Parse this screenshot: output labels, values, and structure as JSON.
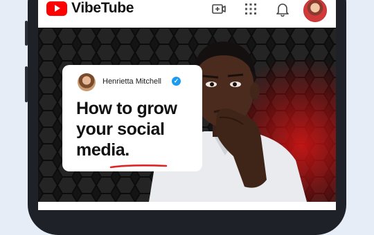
{
  "app": {
    "name": "VibeTube"
  },
  "icons": {
    "logo": "play-logo-icon",
    "create": "create-video-icon",
    "apps": "apps-grid-icon",
    "notifications": "bell-icon",
    "avatar": "user-avatar"
  },
  "thumbnail": {
    "creator_name": "Henrietta Mitchell",
    "verified_icon": "verified-check-icon",
    "headline_lines": [
      "How to grow",
      "your social",
      "media."
    ]
  },
  "colors": {
    "brand_red": "#ff0000",
    "verified_blue": "#1d9bf0",
    "thumb_background": "#141414",
    "underline_red": "#e02424"
  }
}
